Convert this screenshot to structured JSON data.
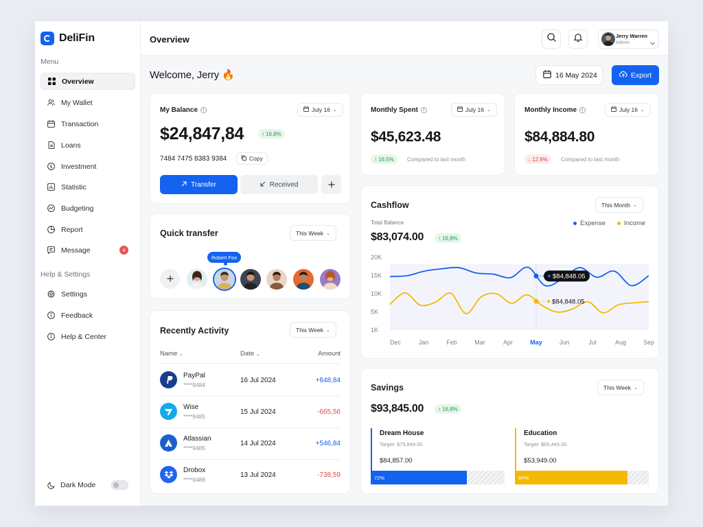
{
  "brand": {
    "name": "DeliFin"
  },
  "sidebar": {
    "menu_title": "Menu",
    "items": [
      {
        "label": "Overview",
        "icon": "grid-icon"
      },
      {
        "label": "My Wallet",
        "icon": "users-icon"
      },
      {
        "label": "Transaction",
        "icon": "calendar-icon"
      },
      {
        "label": "Loans",
        "icon": "document-icon"
      },
      {
        "label": "Investment",
        "icon": "dollar-circle-icon"
      },
      {
        "label": "Statistic",
        "icon": "chart-icon"
      },
      {
        "label": "Budgeting",
        "icon": "trend-icon"
      },
      {
        "label": "Report",
        "icon": "pie-icon"
      },
      {
        "label": "Message",
        "icon": "message-icon",
        "badge": "4"
      }
    ],
    "help_title": "Help & Settings",
    "help_items": [
      {
        "label": "Settings",
        "icon": "gear-icon"
      },
      {
        "label": "Feedback",
        "icon": "info-icon"
      },
      {
        "label": "Help & Center",
        "icon": "info-icon"
      }
    ],
    "dark_mode": "Dark Mode"
  },
  "header": {
    "title": "Overview",
    "user": {
      "name": "Jerry Warren",
      "role": "Admin"
    }
  },
  "welcome": {
    "text": "Welcome, Jerry",
    "emoji": "🔥",
    "date": "16 May 2024",
    "export": "Export"
  },
  "balance": {
    "title": "My Balance",
    "period": "July 16",
    "amount": "$24,847,84",
    "change": "16,8%",
    "card_number": "7484 7475 8383 9384",
    "copy": "Copy",
    "transfer": "Transfer",
    "received": "Received"
  },
  "monthly_spent": {
    "title": "Monthly Spent",
    "period": "July 16",
    "amount": "$45,623.48",
    "change": "16.5%",
    "note": "Compared to last month"
  },
  "monthly_income": {
    "title": "Monthly Income",
    "period": "July 16",
    "amount": "$84,884.80",
    "change": "12.8%",
    "note": "Compared to last month"
  },
  "quick_transfer": {
    "title": "Quick transfer",
    "period": "This Week",
    "tooltip": "Robert Fox"
  },
  "recent": {
    "title": "Recently Activity",
    "period": "This Week",
    "columns": {
      "name": "Name",
      "date": "Date",
      "amount": "Amount"
    },
    "rows": [
      {
        "name": "PayPal",
        "account": "****9484",
        "date": "16 Jul 2024",
        "amount": "+848,84",
        "color": "#1a3c8f"
      },
      {
        "name": "Wise",
        "account": "****9485",
        "date": "15 Jul 2024",
        "amount": "-665,56",
        "color": "#16a9e8"
      },
      {
        "name": "Atlassian",
        "account": "****9485",
        "date": "14 Jul 2024",
        "amount": "+546,84",
        "color": "#1a5fd0"
      },
      {
        "name": "Drobox",
        "account": "****9486",
        "date": "13 Jul 2024",
        "amount": "-738,59",
        "color": "#2064f0"
      }
    ]
  },
  "cashflow": {
    "title": "Cashflow",
    "period": "This Month",
    "balance_label": "Total Balance",
    "balance": "$83,074.00",
    "change": "16,8%",
    "legend": {
      "expense": "Expense",
      "income": "Income"
    },
    "tooltip_expense": "$84,848.05",
    "tooltip_income": "$84,848.05"
  },
  "chart_data": {
    "type": "line",
    "categories": [
      "Dec",
      "Jan",
      "Feb",
      "Mar",
      "Apr",
      "May",
      "Jun",
      "Jul",
      "Aug",
      "Sep"
    ],
    "y_ticks": [
      "20K",
      "15K",
      "10K",
      "5K",
      "1K"
    ],
    "ylim": [
      1,
      20
    ],
    "highlight": "May",
    "series": [
      {
        "name": "Expense",
        "color": "#1462f0",
        "values": [
          15,
          15.2,
          16.4,
          17,
          17.3,
          15.9,
          15.6,
          14.7,
          17.4,
          12.6,
          14.4,
          17.3,
          14.8,
          16.4,
          12.6,
          15.2
        ]
      },
      {
        "name": "Income",
        "color": "#f5b800",
        "values": [
          7.7,
          10.7,
          7.5,
          8.3,
          10.6,
          5.3,
          9.7,
          10.5,
          8,
          10.2,
          7.4,
          5.7,
          6.5,
          8.4,
          5.5,
          7.6,
          8.1,
          8.4
        ]
      }
    ]
  },
  "savings": {
    "title": "Savings",
    "period": "This Week",
    "amount": "$93,845.00",
    "change": "16,8%",
    "goals": [
      {
        "name": "Dream House",
        "target": "Target: $75,849.00",
        "saved": "$84,857.00",
        "progress": 72,
        "progress_label": "72%",
        "color": "#1462f0"
      },
      {
        "name": "Education",
        "target": "Target: $65,445.00",
        "saved": "$53,949.00",
        "progress": 84,
        "progress_label": "84%",
        "color": "#f5b800"
      }
    ]
  }
}
